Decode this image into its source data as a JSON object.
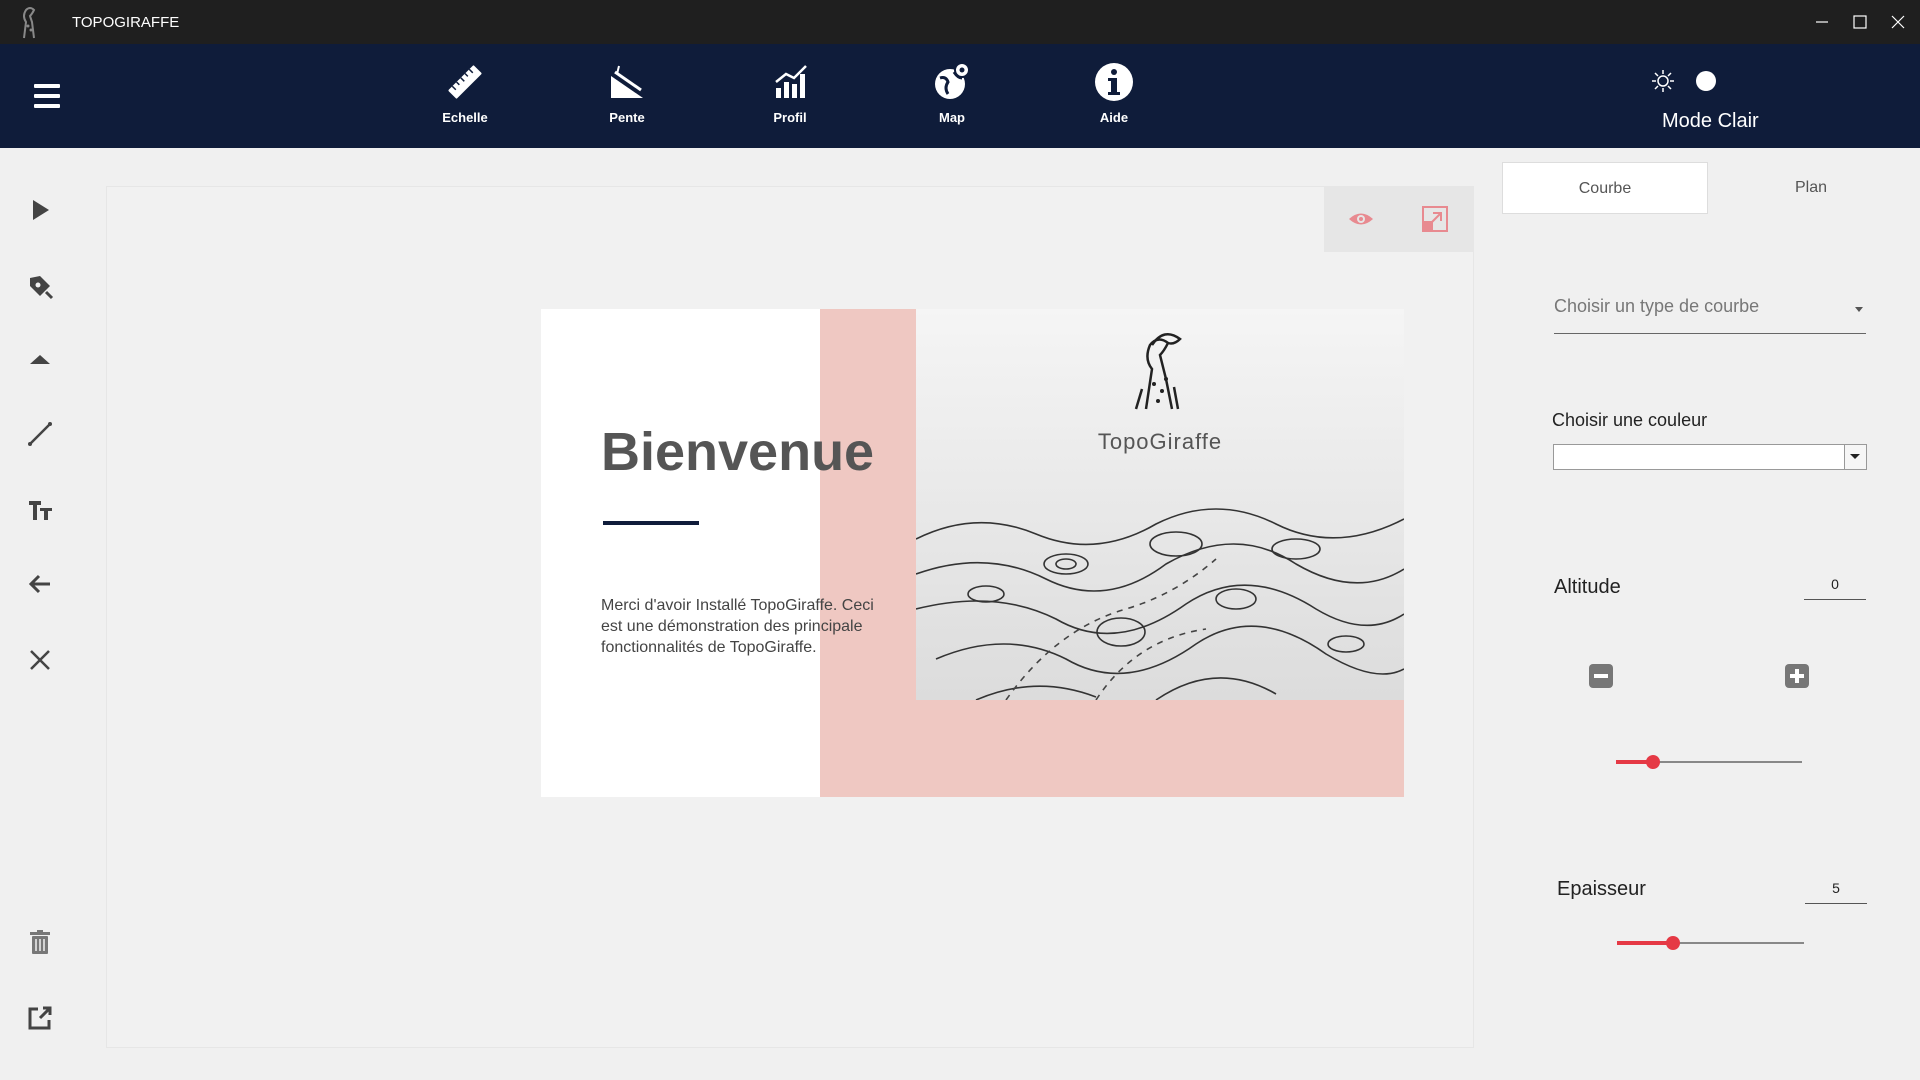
{
  "window": {
    "title": "TOPOGIRAFFE"
  },
  "nav": {
    "items": [
      {
        "label": "Echelle",
        "icon": "ruler-icon"
      },
      {
        "label": "Pente",
        "icon": "slope-icon"
      },
      {
        "label": "Profil",
        "icon": "profile-chart-icon"
      },
      {
        "label": "Map",
        "icon": "globe-icon"
      },
      {
        "label": "Aide",
        "icon": "info-icon"
      }
    ],
    "mode_label": "Mode Clair"
  },
  "tools": [
    "pointer-icon",
    "pen-icon",
    "triangle-up-icon",
    "line-icon",
    "text-icon",
    "undo-arrow-icon",
    "close-icon",
    "trash-icon",
    "export-icon"
  ],
  "slide": {
    "title": "Bienvenue",
    "description": "Merci d'avoir Installé TopoGiraffe. Ceci est une démonstration des principale fonctionnalités de TopoGiraffe.",
    "brand": "TopoGiraffe"
  },
  "panel": {
    "tabs": [
      {
        "label": "Courbe",
        "active": true
      },
      {
        "label": "Plan",
        "active": false
      }
    ],
    "curve_type_placeholder": "Choisir un type de courbe",
    "color_label": "Choisir une couleur",
    "color_value": "",
    "altitude": {
      "label": "Altitude",
      "value": "0",
      "slider_fraction": 0.2
    },
    "epaisseur": {
      "label": "Epaisseur",
      "value": "5",
      "slider_fraction": 0.3
    }
  },
  "colors": {
    "nav_bg": "#0f1c3a",
    "accent": "#e53945",
    "slide_pink": "#efc8c2"
  }
}
